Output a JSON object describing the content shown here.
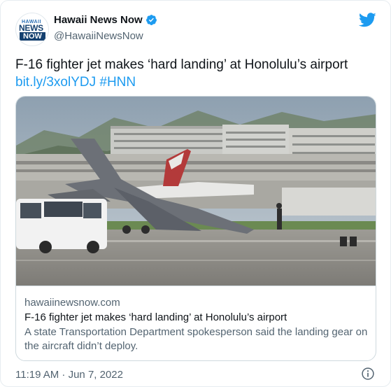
{
  "account": {
    "avatar_line1": "HAWAII",
    "avatar_line2": "NEWS",
    "avatar_line3": "NOW",
    "display_name": "Hawaii News Now",
    "handle": "@HawaiiNewsNow",
    "verified_icon": "verified-badge-icon"
  },
  "brand": {
    "logo_icon": "twitter-bird-icon",
    "accent": "#1d9bf0"
  },
  "tweet": {
    "text": "F-16 fighter jet makes ‘hard landing’ at Honolulu’s airport",
    "link": "bit.ly/3xolYDJ",
    "hashtag": "#HNN"
  },
  "card": {
    "image_icon": "photo-f16-on-runway",
    "domain": "hawaiinewsnow.com",
    "title": "F-16 fighter jet makes ‘hard landing’ at Honolulu’s airport",
    "description": "A state Transportation Department spokesperson said the landing gear on the aircraft didn’t deploy."
  },
  "footer": {
    "timestamp": "11:19 AM · Jun 7, 2022",
    "info_icon": "info-icon"
  }
}
